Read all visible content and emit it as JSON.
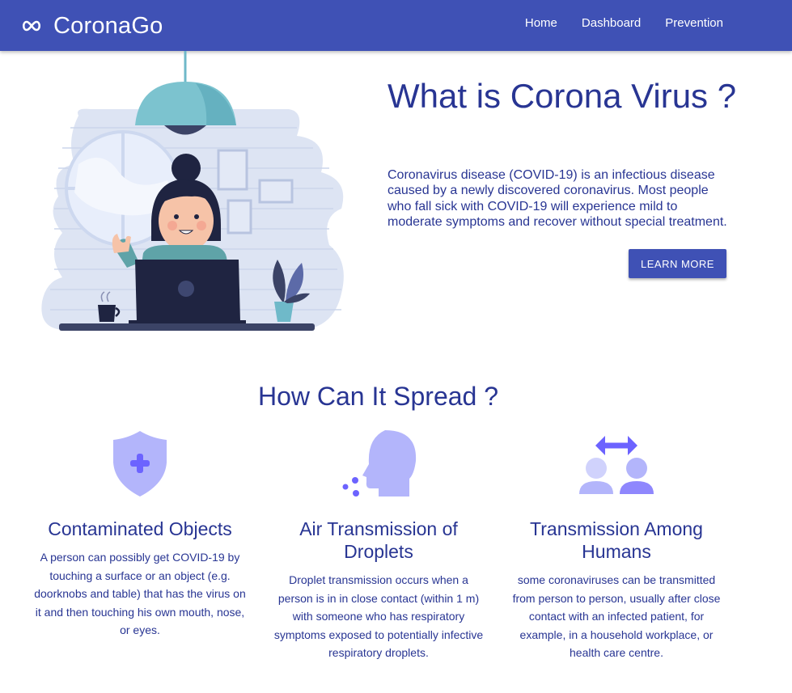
{
  "navbar": {
    "brand": "CoronaGo",
    "brand_icon": "infinity-icon",
    "links": [
      "Home",
      "Dashboard",
      "Prevention"
    ]
  },
  "hero": {
    "illustration": "woman-at-laptop-illustration",
    "title": "What is Corona Virus ?",
    "description": "Coronavirus disease (COVID-19) is an infectious disease caused by a newly discovered coronavirus. Most people who fall sick with COVID-19 will experience mild to moderate symptoms and recover without special treatment.",
    "button": "LEARN MORE"
  },
  "spread": {
    "title": "How Can It Spread ?",
    "cards": [
      {
        "icon": "shield-plus-icon",
        "title": "Contaminated Objects",
        "text": "A person can possibly get COVID-19 by touching a surface or an object (e.g. doorknobs and table) that has the virus on it and then touching his own mouth, nose, or eyes."
      },
      {
        "icon": "head-droplets-icon",
        "title": "Air Transmission of Droplets",
        "text": "Droplet transmission occurs when a person is in in close contact (within 1 m) with someone who has respiratory symptoms exposed to potentially infective respiratory droplets."
      },
      {
        "icon": "people-exchange-icon",
        "title": "Transmission Among Humans",
        "text": "some coronaviruses can be transmitted from person to person, usually after close contact with an infected patient, for example, in a household workplace, or health care centre."
      }
    ]
  },
  "colors": {
    "primary": "#3f51b5",
    "heading": "#283593",
    "icon_light": "#b3b5fb",
    "icon_dark": "#6c63ff"
  }
}
